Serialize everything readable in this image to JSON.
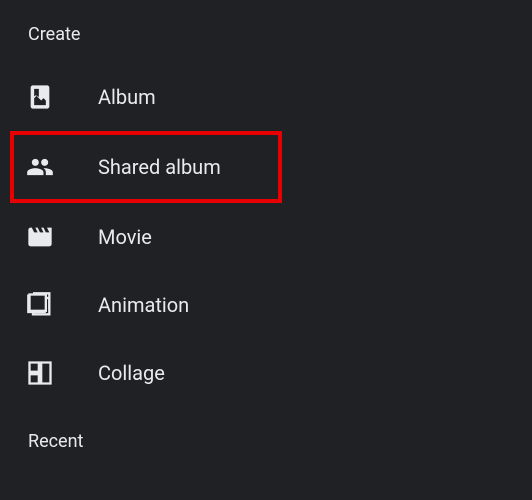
{
  "sections": {
    "create": {
      "header": "Create",
      "items": [
        {
          "label": "Album",
          "icon": "album"
        },
        {
          "label": "Shared album",
          "icon": "shared",
          "highlighted": true
        },
        {
          "label": "Movie",
          "icon": "movie"
        },
        {
          "label": "Animation",
          "icon": "animation"
        },
        {
          "label": "Collage",
          "icon": "collage"
        }
      ]
    },
    "recent": {
      "header": "Recent"
    }
  }
}
